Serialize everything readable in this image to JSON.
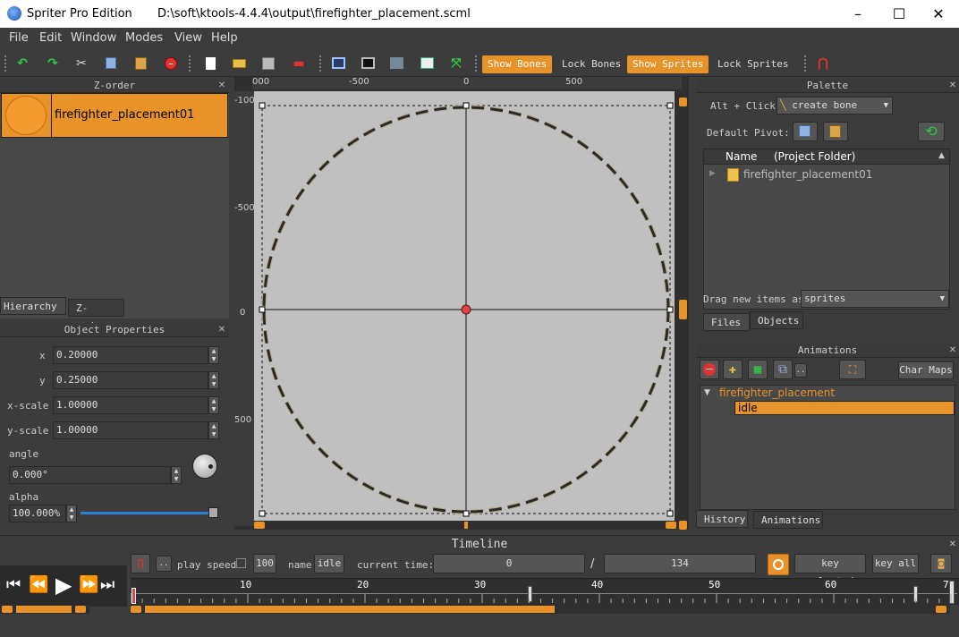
{
  "window": {
    "app_title": "Spriter Pro Edition",
    "file_path": "D:\\soft\\ktools-4.4.4\\output\\firefighter_placement.scml",
    "minimize": "–",
    "maximize": "☐",
    "close": "✕"
  },
  "menu": [
    "File",
    "Edit",
    "Window",
    "Modes",
    "View",
    "Help"
  ],
  "toolbar": {
    "show_bones": "Show Bones",
    "lock_bones": "Lock Bones",
    "show_sprites": "Show Sprites",
    "lock_sprites": "Lock Sprites"
  },
  "zorder": {
    "title": "Z-order",
    "item": "firefighter_placement01",
    "tabs": [
      "Hierarchy",
      "Z-order"
    ]
  },
  "object_properties": {
    "title": "Object Properties",
    "x_label": "x",
    "x_value": "0.20000",
    "y_label": "y",
    "y_value": "0.25000",
    "xscale_label": "x-scale",
    "xscale_value": "1.00000",
    "yscale_label": "y-scale",
    "yscale_value": "1.00000",
    "angle_label": "angle",
    "angle_value": "0.000°",
    "alpha_label": "alpha",
    "alpha_value": "100.000%",
    "alpha_fraction": 1.0
  },
  "canvas": {
    "ruler_top": [
      "000",
      "-500",
      "0",
      "500"
    ],
    "ruler_left": [
      "-100",
      "-500",
      "0",
      "500"
    ]
  },
  "palette": {
    "title": "Palette",
    "alt_click": "Alt + Click:",
    "create_bone": "create bone",
    "default_pivot": "Default Pivot:",
    "col_name": "Name",
    "col_folder": "(Project Folder)",
    "folder_item": "firefighter_placement01",
    "drag_label": "Drag new items as",
    "drag_value": "sprites",
    "tabs": [
      "Files",
      "Objects"
    ]
  },
  "animations": {
    "title": "Animations",
    "char_maps": "Char Maps",
    "entity": "firefighter_placement",
    "anim": "idle",
    "tabs": [
      "History",
      "Animations"
    ]
  },
  "timeline": {
    "title": "Timeline",
    "play_speed_label": "play speed",
    "play_speed_value": "100",
    "name_label": "name",
    "name_value": "idle",
    "current_time_label": "current time:",
    "current_time": "0",
    "slash": "/",
    "total_time": "134",
    "key_selected": "key selected",
    "key_all": "key all",
    "ticks": [
      "10",
      "20",
      "30",
      "40",
      "50",
      "60",
      "7"
    ]
  },
  "colors": {
    "accent": "#e8922a",
    "panel": "#3c3c3c",
    "canvas": "#c0c0c0"
  }
}
